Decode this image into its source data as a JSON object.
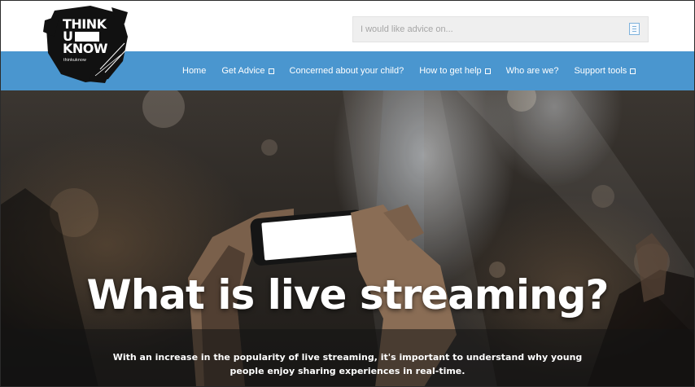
{
  "logo": {
    "line1": "THINK",
    "line2": "U",
    "line3": "KNOW",
    "tagline": "thinkuknow"
  },
  "search": {
    "placeholder": "I would like advice on...",
    "button_icon": "search-icon"
  },
  "nav": {
    "items": [
      {
        "label": "Home",
        "dropdown": false
      },
      {
        "label": "Get Advice",
        "dropdown": true
      },
      {
        "label": "Concerned about your child?",
        "dropdown": false
      },
      {
        "label": "How to get help",
        "dropdown": true
      },
      {
        "label": "Who are we?",
        "dropdown": false
      },
      {
        "label": "Support tools",
        "dropdown": true
      }
    ]
  },
  "hero": {
    "title": "What is live streaming?",
    "caption": "With an increase in the popularity of live streaming, it's important to understand why young people enjoy sharing experiences in real-time."
  },
  "colors": {
    "nav_bg": "#4a96cf",
    "logo_bg": "#111111",
    "search_bg": "#efefef"
  }
}
